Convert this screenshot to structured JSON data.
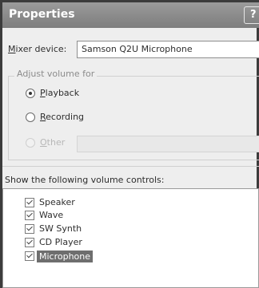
{
  "window": {
    "title": "Properties",
    "help_label": "?"
  },
  "mixer": {
    "label": "Mixer device:",
    "value": "Samson Q2U Microphone"
  },
  "adjust_group": {
    "legend": "Adjust volume for",
    "options": [
      {
        "label": "Playback",
        "selected": true
      },
      {
        "label": "Recording",
        "selected": false
      },
      {
        "label": "Other",
        "selected": false,
        "disabled": true
      }
    ]
  },
  "volume_controls": {
    "header": "Show the following volume controls:",
    "items": [
      {
        "label": "Speaker",
        "checked": true
      },
      {
        "label": "Wave",
        "checked": true
      },
      {
        "label": "SW Synth",
        "checked": true
      },
      {
        "label": "CD Player",
        "checked": true
      },
      {
        "label": "Microphone",
        "checked": true,
        "selected": true
      }
    ]
  }
}
